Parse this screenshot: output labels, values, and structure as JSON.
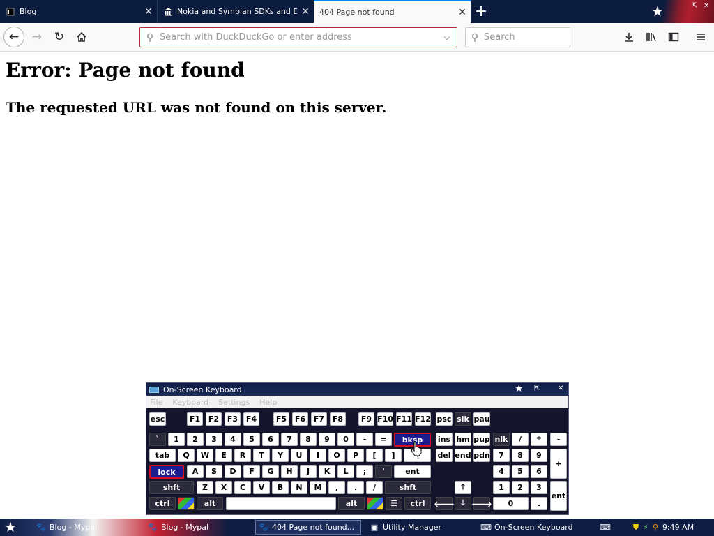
{
  "browser": {
    "tabs": [
      {
        "title": "Blog",
        "icon": "tab-favicon-dark"
      },
      {
        "title": "Nokia and Symbian SDKs and Dev",
        "icon": "museum-icon"
      },
      {
        "title": "404 Page not found",
        "icon": ""
      }
    ],
    "new_tab_symbol": "+",
    "address_placeholder": "Search with DuckDuckGo or enter address",
    "search_placeholder": "Search",
    "accent": "#0a84ff",
    "url_focus_color": "#b52b3a"
  },
  "page": {
    "heading": "Error: Page not found",
    "message": "The requested URL was not found on this server."
  },
  "osk": {
    "title": "On-Screen Keyboard",
    "menu": [
      "File",
      "Keyboard",
      "Settings",
      "Help"
    ],
    "keys": {
      "esc": "esc",
      "f1": "F1",
      "f2": "F2",
      "f3": "F3",
      "f4": "F4",
      "f5": "F5",
      "f6": "F6",
      "f7": "F7",
      "f8": "F8",
      "f9": "F9",
      "f10": "F10",
      "f11": "F11",
      "f12": "F12",
      "psc": "psc",
      "slk": "slk",
      "pau": "pau",
      "grave": "`",
      "n1": "1",
      "n2": "2",
      "n3": "3",
      "n4": "4",
      "n5": "5",
      "n6": "6",
      "n7": "7",
      "n8": "8",
      "n9": "9",
      "n0": "0",
      "minus": "-",
      "equals": "=",
      "bksp": "bksp",
      "ins": "ins",
      "hm": "hm",
      "pup": "pup",
      "nlk": "nlk",
      "np_div": "/",
      "np_mul": "*",
      "np_sub": "-",
      "tab": "tab",
      "q": "Q",
      "w": "W",
      "e": "E",
      "r": "R",
      "t": "T",
      "y": "Y",
      "u": "U",
      "i": "I",
      "o": "O",
      "p": "P",
      "lbr": "[",
      "rbr": "]",
      "bsl": "\\",
      "del": "del",
      "end": "end",
      "pdn": "pdn",
      "np7": "7",
      "np8": "8",
      "np9": "9",
      "np_add": "+",
      "lock": "lock",
      "a": "A",
      "s": "S",
      "d": "D",
      "f": "F",
      "g": "G",
      "h": "H",
      "j": "J",
      "k": "K",
      "l": "L",
      "semi": ";",
      "quote": "'",
      "ent": "ent",
      "np4": "4",
      "np5": "5",
      "np6": "6",
      "lshft": "shft",
      "z": "Z",
      "x": "X",
      "c": "C",
      "v": "V",
      "b": "B",
      "n": "N",
      "m": "M",
      "comma": ",",
      "period": ".",
      "slash": "/",
      "rshft": "shft",
      "up": "🡑",
      "np1": "1",
      "np2": "2",
      "np3": "3",
      "np_ent": "ent",
      "lctrl": "ctrl",
      "lalt": "alt",
      "ralt": "alt",
      "rctrl": "ctrl",
      "left": "🡐",
      "down": "🡓",
      "right": "🡒",
      "np0": "0",
      "np_dot": "."
    }
  },
  "taskbar": {
    "items": [
      "Blog - Mypal",
      "Blog - Mypal",
      "404 Page not found...",
      "Utility Manager",
      "On-Screen Keyboard"
    ],
    "clock": "9:49 AM"
  }
}
